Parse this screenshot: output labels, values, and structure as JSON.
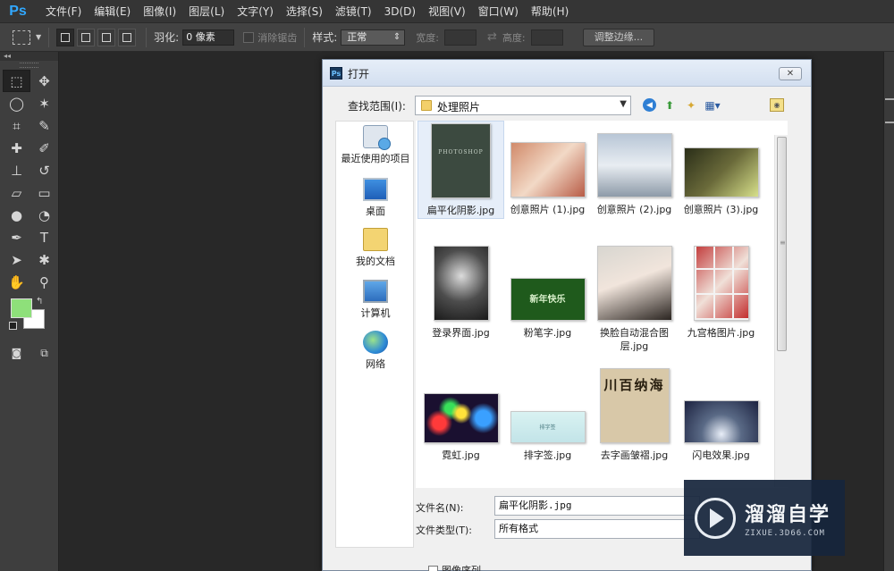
{
  "app": {
    "logo": "Ps",
    "menu": [
      "文件(F)",
      "编辑(E)",
      "图像(I)",
      "图层(L)",
      "文字(Y)",
      "选择(S)",
      "滤镜(T)",
      "3D(D)",
      "视图(V)",
      "窗口(W)",
      "帮助(H)"
    ]
  },
  "options": {
    "feather_label": "羽化:",
    "feather_value": "0 像素",
    "antialias_label": "消除锯齿",
    "style_label": "样式:",
    "style_value": "正常",
    "width_label": "宽度:",
    "height_label": "高度:",
    "refine_button": "调整边缘..."
  },
  "toolbar": {
    "collapse": "◂◂",
    "foreground_color": "#8ee07a",
    "background_color": "#ffffff"
  },
  "dialog": {
    "title_icon": "Ps",
    "title": "打开",
    "close": "✕",
    "lookin_label": "查找范围(I):",
    "lookin_value": "处理照片",
    "places": [
      {
        "label": "最近使用的项目",
        "icon": "recent-items-icon"
      },
      {
        "label": "桌面",
        "icon": "desktop-icon"
      },
      {
        "label": "我的文档",
        "icon": "documents-icon"
      },
      {
        "label": "计算机",
        "icon": "computer-icon"
      },
      {
        "label": "网络",
        "icon": "network-icon"
      }
    ],
    "files": [
      {
        "name": "扁平化阴影.jpg",
        "thumb_text": "PHOTOSHOP",
        "selected": true
      },
      {
        "name": "创意照片 (1).jpg"
      },
      {
        "name": "创意照片 (2).jpg"
      },
      {
        "name": "创意照片 (3).jpg"
      },
      {
        "name": "登录界面.jpg"
      },
      {
        "name": "粉笔字.jpg",
        "thumb_text": "新年快乐"
      },
      {
        "name": "换脸自动混合图层.jpg"
      },
      {
        "name": "九宫格图片.jpg"
      },
      {
        "name": "霓虹.jpg"
      },
      {
        "name": "排字签.jpg",
        "thumb_text": "排字签"
      },
      {
        "name": "去字画皱褶.jpg",
        "thumb_text": "川百纳海"
      },
      {
        "name": "闪电效果.jpg"
      }
    ],
    "filename_label": "文件名(N):",
    "filename_value": "扁平化阴影.jpg",
    "filetype_label": "文件类型(T):",
    "filetype_value": "所有格式",
    "image_sequence": "图像序列"
  },
  "watermark": {
    "title": "溜溜自学",
    "subtitle": "ZIXUE.3D66.COM"
  }
}
